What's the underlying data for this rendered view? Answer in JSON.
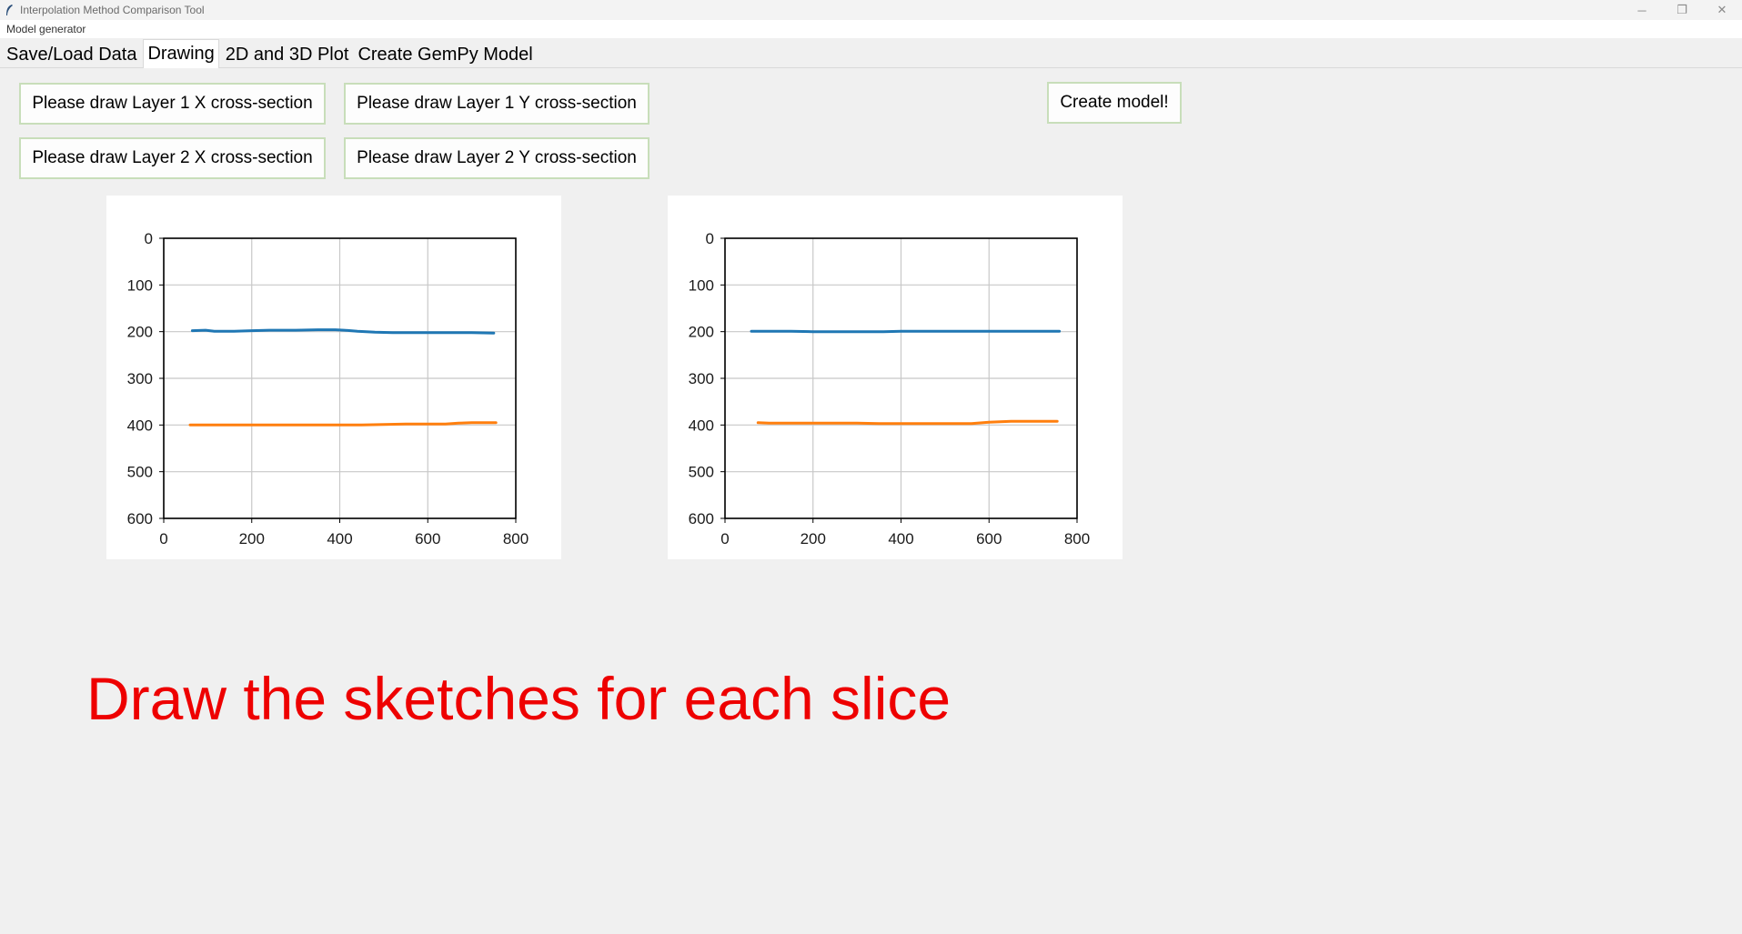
{
  "window": {
    "title": "Interpolation Method Comparison Tool",
    "subtitle": "Model generator",
    "controls": {
      "minimize": "─",
      "restore": "❐",
      "close": "✕"
    }
  },
  "tabs": [
    {
      "label": "Save/Load Data",
      "active": false
    },
    {
      "label": "Drawing",
      "active": true
    },
    {
      "label": "2D and 3D Plot",
      "active": false
    },
    {
      "label": "Create GemPy Model",
      "active": false
    }
  ],
  "buttons": {
    "layer1_x": "Please draw Layer 1 X cross-section",
    "layer1_y": "Please draw Layer 1 Y cross-section",
    "layer2_x": "Please draw Layer 2 X cross-section",
    "layer2_y": "Please draw Layer 2 Y cross-section",
    "create_model": "Create model!"
  },
  "banner": "Draw the sketches for each slice",
  "colors": {
    "layer1": "#1f77b4",
    "layer2": "#ff7f0e",
    "banner": "#ee0000",
    "button_border": "#c8deba"
  },
  "chart_data": [
    {
      "type": "line",
      "xlim": [
        0,
        800
      ],
      "ylim": [
        600,
        0
      ],
      "y_inverted": true,
      "grid": true,
      "xticks": [
        0,
        200,
        400,
        600,
        800
      ],
      "yticks": [
        0,
        100,
        200,
        300,
        400,
        500,
        600
      ],
      "series": [
        {
          "color": "#1f77b4",
          "x": [
            65,
            95,
            115,
            160,
            200,
            240,
            300,
            350,
            390,
            410,
            440,
            480,
            520,
            560,
            600,
            650,
            700,
            750
          ],
          "y": [
            198,
            197,
            199,
            199,
            198,
            197,
            197,
            196,
            196,
            197,
            199,
            201,
            202,
            202,
            202,
            202,
            202,
            203
          ]
        },
        {
          "color": "#ff7f0e",
          "x": [
            60,
            100,
            150,
            200,
            250,
            300,
            350,
            400,
            450,
            500,
            550,
            600,
            640,
            670,
            700,
            755
          ],
          "y": [
            400,
            400,
            400,
            400,
            400,
            400,
            400,
            400,
            400,
            399,
            398,
            398,
            398,
            396,
            395,
            395
          ]
        }
      ]
    },
    {
      "type": "line",
      "xlim": [
        0,
        800
      ],
      "ylim": [
        600,
        0
      ],
      "y_inverted": true,
      "grid": true,
      "xticks": [
        0,
        200,
        400,
        600,
        800
      ],
      "yticks": [
        0,
        100,
        200,
        300,
        400,
        500,
        600
      ],
      "series": [
        {
          "color": "#1f77b4",
          "x": [
            60,
            100,
            150,
            200,
            250,
            300,
            360,
            400,
            450,
            500,
            550,
            600,
            650,
            700,
            760
          ],
          "y": [
            199,
            199,
            199,
            200,
            200,
            200,
            200,
            199,
            199,
            199,
            199,
            199,
            199,
            199,
            199
          ]
        },
        {
          "color": "#ff7f0e",
          "x": [
            75,
            100,
            150,
            200,
            250,
            300,
            350,
            400,
            450,
            500,
            560,
            600,
            650,
            700,
            755
          ],
          "y": [
            395,
            396,
            396,
            396,
            396,
            396,
            397,
            397,
            397,
            397,
            397,
            394,
            392,
            392,
            392
          ]
        }
      ]
    }
  ]
}
